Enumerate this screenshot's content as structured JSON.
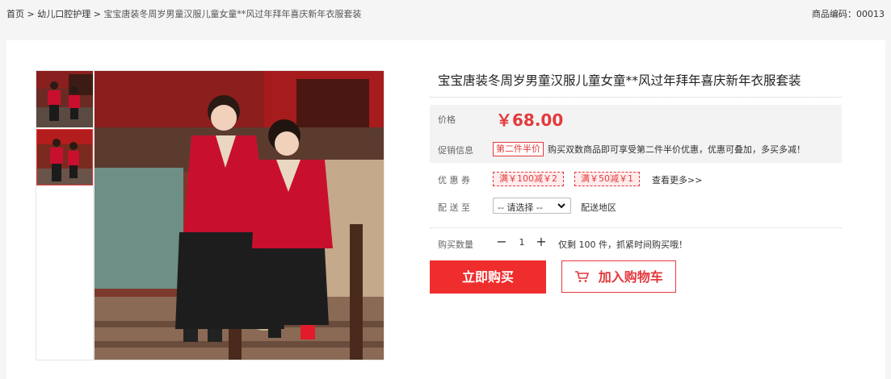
{
  "breadcrumb": {
    "home": "首页",
    "sep": ">",
    "category": "幼儿口腔护理",
    "current": "宝宝唐装冬周岁男童汉服儿童女童**风过年拜年喜庆新年衣服套装"
  },
  "product_code": "商品编码：00013",
  "product": {
    "title": "宝宝唐装冬周岁男童汉服儿童女童**风过年拜年喜庆新年衣服套装",
    "price_label": "价格",
    "price": "￥68.00",
    "promo_label": "促销信息",
    "promo_tag": "第二件半价",
    "promo_desc": "购买双数商品即可享受第二件半价优惠，优惠可叠加，多买多减！",
    "coupon_label": "优 惠 券",
    "coupons": [
      "满￥100减￥2",
      "满￥50减￥1"
    ],
    "coupon_more": "查看更多>>",
    "ship_label": "配 送 至",
    "ship_select": "-- 请选择 --",
    "ship_area": "配送地区",
    "qty_label": "购买数量",
    "qty_minus": "−",
    "qty_value": "1",
    "qty_plus": "+",
    "stock_note": "仅剩 100 件，抓紧时间购买哦！",
    "buy_now": "立即购买",
    "add_cart": "加入购物车"
  },
  "icons": {
    "cart": "cart-icon",
    "dropdown": "chevron-down-icon"
  },
  "colors": {
    "accent": "#e4393c",
    "buy_button": "#f02d2d",
    "price_bg": "#f3f3f3"
  }
}
